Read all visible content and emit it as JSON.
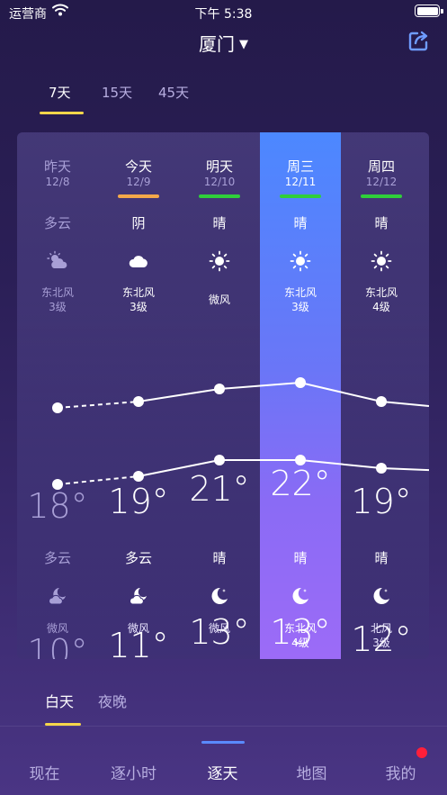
{
  "status_bar": {
    "carrier": "运营商",
    "time": "下午 5:38"
  },
  "header": {
    "city": "厦门",
    "city_caret": "▼"
  },
  "range_tabs": [
    {
      "label": "7天",
      "active": true
    },
    {
      "label": "15天",
      "active": false
    },
    {
      "label": "45天",
      "active": false
    }
  ],
  "days": [
    {
      "name": "昨天",
      "date": "12/8",
      "bar_color": "",
      "day_condition": "多云",
      "day_icon": "partly-cloudy-icon",
      "day_wind": "东北风",
      "day_wind_level": "3级",
      "high": "18°",
      "low": "10°",
      "night_condition": "多云",
      "night_icon": "cloudy-night-icon",
      "night_wind": "微风",
      "night_wind_level": ""
    },
    {
      "name": "今天",
      "date": "12/9",
      "bar_color": "#f4a84a",
      "day_condition": "阴",
      "day_icon": "cloud-icon",
      "day_wind": "东北风",
      "day_wind_level": "3级",
      "high": "19°",
      "low": "11°",
      "night_condition": "多云",
      "night_icon": "cloudy-night-icon",
      "night_wind": "微风",
      "night_wind_level": ""
    },
    {
      "name": "明天",
      "date": "12/10",
      "bar_color": "#2fcf3a",
      "day_condition": "晴",
      "day_icon": "sun-icon",
      "day_wind": "微风",
      "day_wind_level": "",
      "high": "21°",
      "low": "13°",
      "night_condition": "晴",
      "night_icon": "moon-icon",
      "night_wind": "微风",
      "night_wind_level": ""
    },
    {
      "name": "周三",
      "date": "12/11",
      "bar_color": "#2fcf3a",
      "day_condition": "晴",
      "day_icon": "sun-icon",
      "day_wind": "东北风",
      "day_wind_level": "3级",
      "high": "22°",
      "low": "13°",
      "night_condition": "晴",
      "night_icon": "moon-icon",
      "night_wind": "东北风",
      "night_wind_level": "4级"
    },
    {
      "name": "周四",
      "date": "12/12",
      "bar_color": "#2fcf3a",
      "day_condition": "晴",
      "day_icon": "sun-icon",
      "day_wind": "东北风",
      "day_wind_level": "4级",
      "high": "19°",
      "low": "12°",
      "night_condition": "晴",
      "night_icon": "moon-icon",
      "night_wind": "北风",
      "night_wind_level": "3级"
    }
  ],
  "temps": {
    "highs": [
      18,
      19,
      21,
      22,
      19
    ],
    "lows": [
      10,
      11,
      13,
      13,
      12
    ]
  },
  "day_night_tabs": [
    {
      "label": "白天",
      "active": true
    },
    {
      "label": "夜晚",
      "active": false
    }
  ],
  "bottom_nav": [
    {
      "label": "现在",
      "active": false
    },
    {
      "label": "逐小时",
      "active": false
    },
    {
      "label": "逐天",
      "active": true
    },
    {
      "label": "地图",
      "active": false
    },
    {
      "label": "我的",
      "active": false
    }
  ],
  "colors": {
    "accent_underline": "#f6d64a",
    "highlight_top": "#4c88ff",
    "highlight_bottom": "#9c6bf7",
    "nav_indicator": "#5a8bff",
    "badge": "#ff1f3a"
  }
}
